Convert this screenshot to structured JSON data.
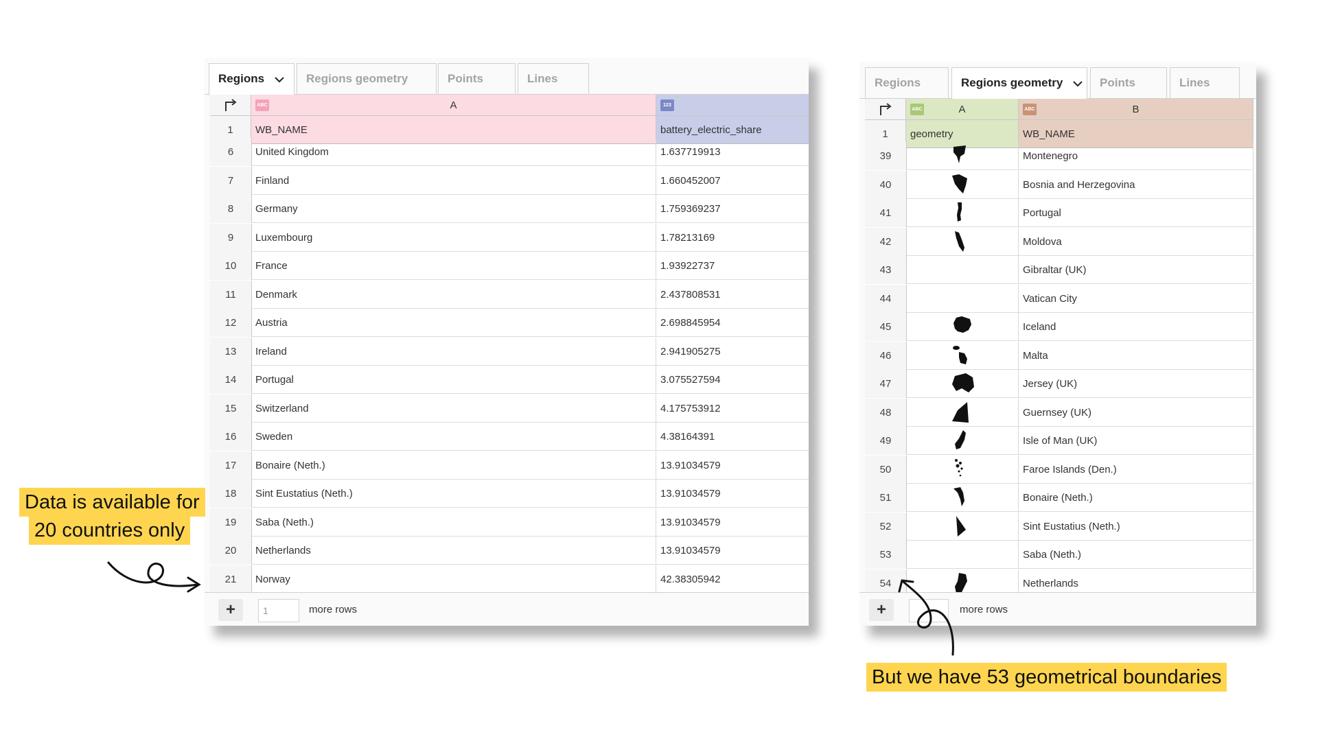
{
  "left_panel": {
    "tabs": [
      {
        "label": "Regions",
        "active": true
      },
      {
        "label": "Regions geometry",
        "active": false
      },
      {
        "label": "Points",
        "active": false
      },
      {
        "label": "Lines",
        "active": false
      }
    ],
    "columns": [
      {
        "letter": "A",
        "type_badge": "ABC",
        "field": "WB_NAME",
        "header_color": "#fcdbe3",
        "badge_color": "#f4a3b7"
      },
      {
        "letter": "",
        "type_badge": "123",
        "field": "battery_electric_share",
        "header_color": "#c8cde8",
        "badge_color": "#7d88c8"
      }
    ],
    "header_row_number": "1",
    "rows": [
      {
        "n": "6",
        "a": "United Kingdom",
        "b": "1.637719913"
      },
      {
        "n": "7",
        "a": "Finland",
        "b": "1.660452007"
      },
      {
        "n": "8",
        "a": "Germany",
        "b": "1.759369237"
      },
      {
        "n": "9",
        "a": "Luxembourg",
        "b": "1.78213169"
      },
      {
        "n": "10",
        "a": "France",
        "b": "1.93922737"
      },
      {
        "n": "11",
        "a": "Denmark",
        "b": "2.437808531"
      },
      {
        "n": "12",
        "a": "Austria",
        "b": "2.698845954"
      },
      {
        "n": "13",
        "a": "Ireland",
        "b": "2.941905275"
      },
      {
        "n": "14",
        "a": "Portugal",
        "b": "3.075527594"
      },
      {
        "n": "15",
        "a": "Switzerland",
        "b": "4.175753912"
      },
      {
        "n": "16",
        "a": "Sweden",
        "b": "4.38164391"
      },
      {
        "n": "17",
        "a": "Bonaire (Neth.)",
        "b": "13.91034579"
      },
      {
        "n": "18",
        "a": "Sint Eustatius (Neth.)",
        "b": "13.91034579"
      },
      {
        "n": "19",
        "a": "Saba (Neth.)",
        "b": "13.91034579"
      },
      {
        "n": "20",
        "a": "Netherlands",
        "b": "13.91034579"
      },
      {
        "n": "21",
        "a": "Norway",
        "b": "42.38305942"
      }
    ],
    "footer": {
      "add_label": "+",
      "rows_value": "1",
      "more_rows_label": "more rows"
    }
  },
  "right_panel": {
    "tabs": [
      {
        "label": "Regions",
        "active": false
      },
      {
        "label": "Regions geometry",
        "active": true
      },
      {
        "label": "Points",
        "active": false
      },
      {
        "label": "Lines",
        "active": false
      }
    ],
    "columns": [
      {
        "letter": "A",
        "type_badge": "ABC",
        "field": "geometry",
        "header_color": "#dbe8c3",
        "badge_color": "#a9c877"
      },
      {
        "letter": "B",
        "type_badge": "ABC",
        "field": "WB_NAME",
        "header_color": "#e6cfc1",
        "badge_color": "#c99275"
      }
    ],
    "header_row_number": "1",
    "rows": [
      {
        "n": "39",
        "name": "Montenegro",
        "shape": "shield"
      },
      {
        "n": "40",
        "name": "Bosnia and Herzegovina",
        "shape": "triangle-blob"
      },
      {
        "n": "41",
        "name": "Portugal",
        "shape": "vertical-strip"
      },
      {
        "n": "42",
        "name": "Moldova",
        "shape": "slanted-strip"
      },
      {
        "n": "43",
        "name": "Gibraltar (UK)",
        "shape": "none"
      },
      {
        "n": "44",
        "name": "Vatican City",
        "shape": "none"
      },
      {
        "n": "45",
        "name": "Iceland",
        "shape": "island-blob"
      },
      {
        "n": "46",
        "name": "Malta",
        "shape": "two-islands"
      },
      {
        "n": "47",
        "name": "Jersey (UK)",
        "shape": "hexagon"
      },
      {
        "n": "48",
        "name": "Guernsey (UK)",
        "shape": "wedge"
      },
      {
        "n": "49",
        "name": "Isle of Man (UK)",
        "shape": "elongated-island"
      },
      {
        "n": "50",
        "name": "Faroe Islands (Den.)",
        "shape": "scattered-dots"
      },
      {
        "n": "51",
        "name": "Bonaire (Neth.)",
        "shape": "curved-island"
      },
      {
        "n": "52",
        "name": "Sint Eustatius (Neth.)",
        "shape": "triangle"
      },
      {
        "n": "53",
        "name": "Saba (Neth.)",
        "shape": "none"
      },
      {
        "n": "54",
        "name": "Netherlands",
        "shape": "country-blob"
      }
    ],
    "footer": {
      "add_label": "+",
      "more_rows_label": "more rows"
    }
  },
  "annotations": {
    "left_callout_line1": "Data is available for",
    "left_callout_line2": "20 countries only",
    "right_callout": "But we have 53 geometrical boundaries",
    "highlight_color": "#ffd54f"
  },
  "icons": {
    "corner": "corner-arrow-icon",
    "dropdown": "chevron-down-icon"
  }
}
